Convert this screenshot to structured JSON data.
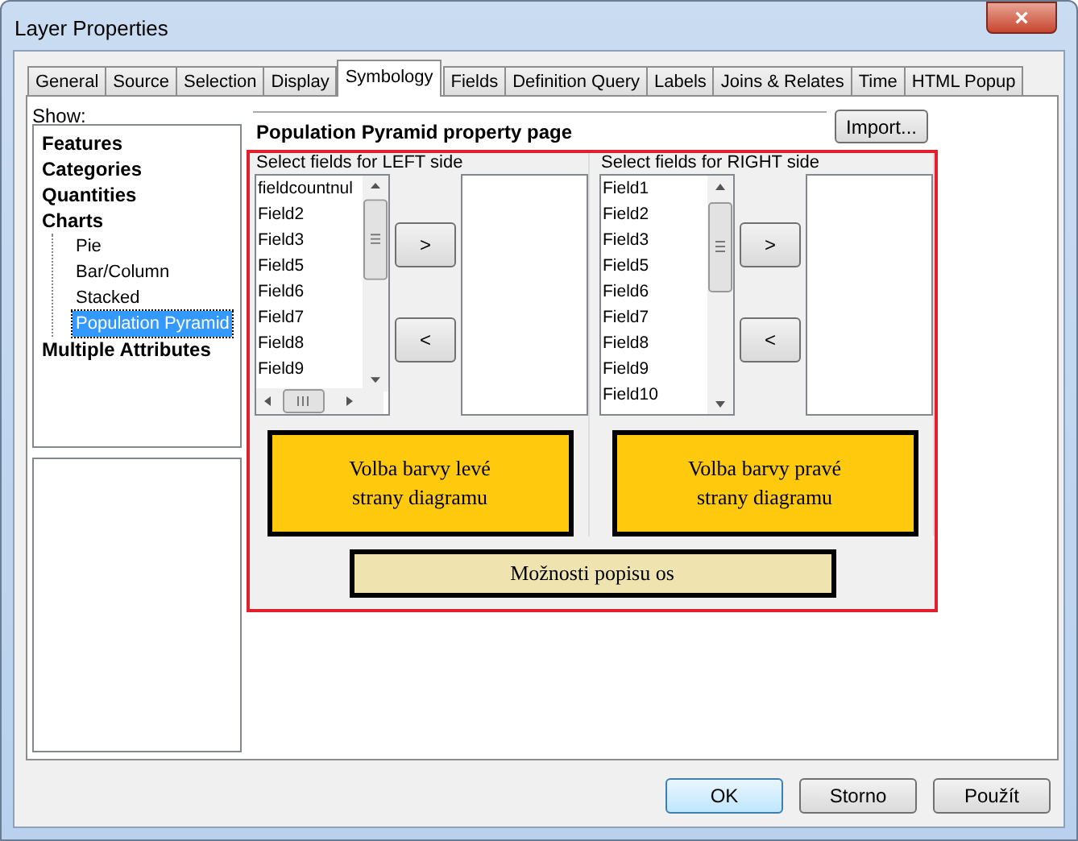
{
  "window": {
    "title": "Layer Properties",
    "close": "×"
  },
  "tabs": [
    {
      "label": "General",
      "selected": false
    },
    {
      "label": "Source",
      "selected": false
    },
    {
      "label": "Selection",
      "selected": false
    },
    {
      "label": "Display",
      "selected": false
    },
    {
      "label": "Symbology",
      "selected": true
    },
    {
      "label": "Fields",
      "selected": false
    },
    {
      "label": "Definition Query",
      "selected": false
    },
    {
      "label": "Labels",
      "selected": false
    },
    {
      "label": "Joins & Relates",
      "selected": false
    },
    {
      "label": "Time",
      "selected": false
    },
    {
      "label": "HTML Popup",
      "selected": false
    }
  ],
  "show_label": "Show:",
  "tree": [
    {
      "label": "Features",
      "selected": false
    },
    {
      "label": "Categories",
      "selected": false
    },
    {
      "label": "Quantities",
      "selected": false
    },
    {
      "label": "Charts",
      "selected": false,
      "children": [
        {
          "label": "Pie",
          "selected": false
        },
        {
          "label": "Bar/Column",
          "selected": false
        },
        {
          "label": "Stacked",
          "selected": false
        },
        {
          "label": "Population Pyramid",
          "selected": true
        }
      ]
    },
    {
      "label": "Multiple Attributes",
      "selected": false
    }
  ],
  "page_title": "Population Pyramid property page",
  "import_button": "Import...",
  "sides": [
    {
      "label": "Select fields for LEFT side",
      "fields": [
        "fieldcountnul",
        "Field2",
        "Field3",
        "Field5",
        "Field6",
        "Field7",
        "Field8",
        "Field9"
      ],
      "horizontal_scrollbar": true,
      "add_button": ">",
      "remove_button": "<",
      "color_button": "Volba barvy levé strany diagramu"
    },
    {
      "label": "Select fields for RIGHT side",
      "fields": [
        "Field1",
        "Field2",
        "Field3",
        "Field5",
        "Field6",
        "Field7",
        "Field8",
        "Field9",
        "Field10"
      ],
      "horizontal_scrollbar": false,
      "add_button": ">",
      "remove_button": "<",
      "color_button": "Volba barvy pravé strany diagramu"
    }
  ],
  "axis_button": "Možnosti popisu os",
  "buttons": [
    {
      "label": "OK",
      "default": true
    },
    {
      "label": "Storno",
      "default": false
    },
    {
      "label": "Použít",
      "default": false
    }
  ]
}
